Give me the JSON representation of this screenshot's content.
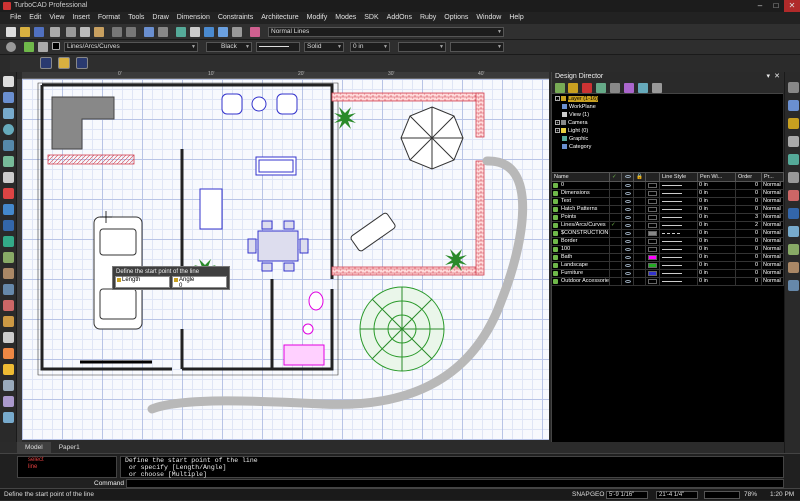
{
  "app": {
    "title": "TurboCAD Professional"
  },
  "window_controls": {
    "minimize": "–",
    "maximize": "□",
    "close": "✕"
  },
  "menu": [
    "File",
    "Edit",
    "View",
    "Insert",
    "Format",
    "Tools",
    "Draw",
    "Dimension",
    "Constraints",
    "Architecture",
    "Modify",
    "Modes",
    "SDK",
    "AddOns",
    "Ruby",
    "Options",
    "Window",
    "Help"
  ],
  "toolbar": {
    "style_combo": "Normal Lines"
  },
  "property_bar": {
    "layer": "Lines/Arcs/Curves",
    "color": "Black",
    "line_style": "Solid",
    "pen_width": "0 in"
  },
  "ruler": {
    "labels": [
      "0'",
      "10'",
      "20'",
      "30'",
      "40'"
    ]
  },
  "canvas_prompt": {
    "title": "Define the start point of the line",
    "field1": "Length",
    "field2": "Angle",
    "value1": "",
    "value2": "0"
  },
  "tabs": {
    "model": "Model",
    "paper": "Paper1"
  },
  "design_director": {
    "title": "Design Director",
    "pin": "📌",
    "close": "✕",
    "tree": [
      {
        "label": "Layer (1-16)",
        "selected": true,
        "expander": "-"
      },
      {
        "label": "WorkPlane"
      },
      {
        "label": "View (1)"
      },
      {
        "label": "Camera",
        "expander": "+"
      },
      {
        "label": "Light (0)",
        "expander": "+"
      },
      {
        "label": "Graphic"
      },
      {
        "label": "Category"
      }
    ],
    "columns": [
      "Name",
      "",
      "",
      "",
      "",
      "Line Style",
      "Pen Wi...",
      "Order",
      "Pr..."
    ],
    "layers": [
      {
        "name": "0",
        "check": "",
        "color": "",
        "style": "solid",
        "pen": "0 in",
        "order": "0",
        "pr": "Normal"
      },
      {
        "name": "Dimensions",
        "check": "",
        "color": "",
        "style": "solid",
        "pen": "0 in",
        "order": "0",
        "pr": "Normal"
      },
      {
        "name": "Text",
        "check": "",
        "color": "",
        "style": "solid",
        "pen": "0 in",
        "order": "0",
        "pr": "Normal"
      },
      {
        "name": "Hatch Patterns",
        "check": "",
        "color": "",
        "style": "solid",
        "pen": "0 in",
        "order": "0",
        "pr": "Normal"
      },
      {
        "name": "Points",
        "check": "",
        "color": "",
        "style": "solid",
        "pen": "0 in",
        "order": "3",
        "pr": "Normal"
      },
      {
        "name": "Lines/Arcs/Curves",
        "check": "✓",
        "color": "",
        "style": "solid",
        "pen": "0 in",
        "order": "2",
        "pr": "Normal"
      },
      {
        "name": "$CONSTRUCTION",
        "check": "",
        "color": "#888888",
        "style": "dash",
        "pen": "0 in",
        "order": "0",
        "pr": "Normal"
      },
      {
        "name": "Border",
        "check": "",
        "color": "",
        "style": "solid",
        "pen": "0 in",
        "order": "0",
        "pr": "Normal"
      },
      {
        "name": "100",
        "check": "",
        "color": "",
        "style": "solid",
        "pen": "0 in",
        "order": "0",
        "pr": "Normal"
      },
      {
        "name": "Bath",
        "check": "",
        "color": "#ff00ff",
        "style": "solid",
        "pen": "0 in",
        "order": "0",
        "pr": "Normal"
      },
      {
        "name": "Landscape",
        "check": "",
        "color": "#22aa22",
        "style": "solid",
        "pen": "0 in",
        "order": "0",
        "pr": "Normal"
      },
      {
        "name": "Furniture",
        "check": "",
        "color": "#3333cc",
        "style": "solid",
        "pen": "0 in",
        "order": "0",
        "pr": "Normal"
      },
      {
        "name": "Outdoor Accessories",
        "check": "",
        "color": "",
        "style": "solid",
        "pen": "0 in",
        "order": "0",
        "pr": "Normal"
      }
    ]
  },
  "command": {
    "history": [
      "select",
      "line"
    ],
    "output": "Define the start point of the line\n or specify [Length/Angle]\n or choose [Multiple]",
    "button": "Command"
  },
  "status": {
    "message": "Define the start point of the line",
    "snap": "SNAP",
    "geo": "GEO",
    "coord_x": "5'-9 1/16\"",
    "coord_y": "21'-4 1/4\"",
    "zoom": "78%",
    "time": "1:20 PM"
  }
}
